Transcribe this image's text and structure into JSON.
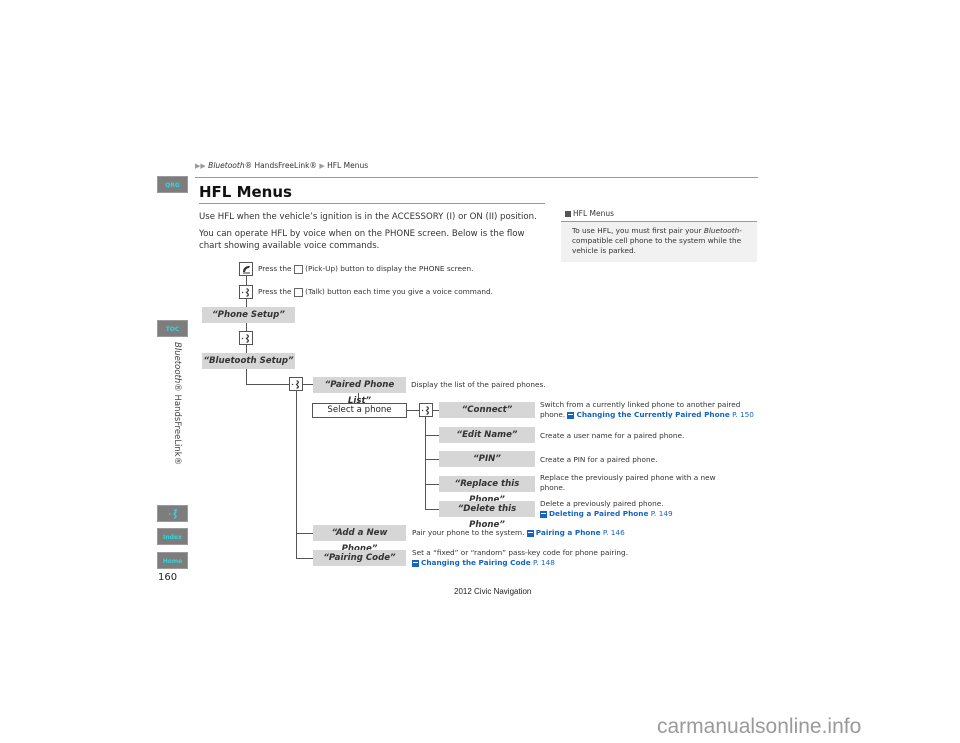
{
  "breadcrumb": {
    "italic_part": "Bluetooth",
    "rest": "® HandsFreeLink®",
    "current": "HFL Menus"
  },
  "side_nav": {
    "qrg": "QRG",
    "toc": "TOC",
    "section_italic": "Bluetooth",
    "section_rest": "® HandsFreeLink®",
    "index": "Index",
    "home": "Home",
    "voice_icon": "talk-icon"
  },
  "page": {
    "title": "HFL Menus",
    "para1": "Use HFL when the vehicle’s ignition is in the ACCESSORY (I) or ON (II) position.",
    "para2": "You can operate HFL by voice when on the PHONE screen. Below is the flow chart showing available voice commands.",
    "page_number": "160",
    "footer": "2012 Civic Navigation",
    "watermark": "carmanualsonline.info"
  },
  "note": {
    "heading": "HFL Menus",
    "text_before": "To use HFL, you must first pair your ",
    "text_italic": "Bluetooth",
    "text_after": "-compatible cell phone to the system while the vehicle is parked."
  },
  "flow": {
    "pickup_instr_a": "Press the",
    "pickup_instr_b": "(Pick-Up) button to display the PHONE screen.",
    "talk_instr_a": "Press the",
    "talk_instr_b": "(Talk) button each time you give a voice command.",
    "phone_setup": "“Phone Setup”",
    "bluetooth_setup": "“Bluetooth Setup”",
    "paired_phone_list": "“Paired Phone List”",
    "paired_phone_list_desc": "Display the list of the paired phones.",
    "select_phone": "Select a phone",
    "connect": "“Connect”",
    "connect_desc": "Switch from a currently linked phone to another paired phone.",
    "connect_link": "Changing the Currently Paired Phone",
    "connect_page": "P. 150",
    "edit_name": "“Edit Name”",
    "edit_name_desc": "Create a user name for a paired phone.",
    "pin": "“PIN”",
    "pin_desc": "Create a PIN for a paired phone.",
    "replace": "“Replace this Phone”",
    "replace_desc": "Replace the previously paired phone with a new phone.",
    "delete": "“Delete this Phone”",
    "delete_desc": "Delete a previously paired phone.",
    "delete_link": "Deleting a Paired Phone",
    "delete_page": "P. 149",
    "add_new": "“Add a New Phone”",
    "add_new_desc": "Pair your phone to the system.",
    "add_new_link": "Pairing a Phone",
    "add_new_page": "P. 146",
    "pairing_code": "“Pairing Code”",
    "pairing_code_desc": "Set a “fixed” or “random” pass-key code for phone pairing.",
    "pairing_code_link": "Changing the Pairing Code",
    "pairing_code_page": "P. 148"
  },
  "colors": {
    "link": "#1565c0",
    "side_button_bg": "#7d7d7d",
    "side_button_text": "#37d3d8",
    "command_bg": "#d6d6d6"
  }
}
